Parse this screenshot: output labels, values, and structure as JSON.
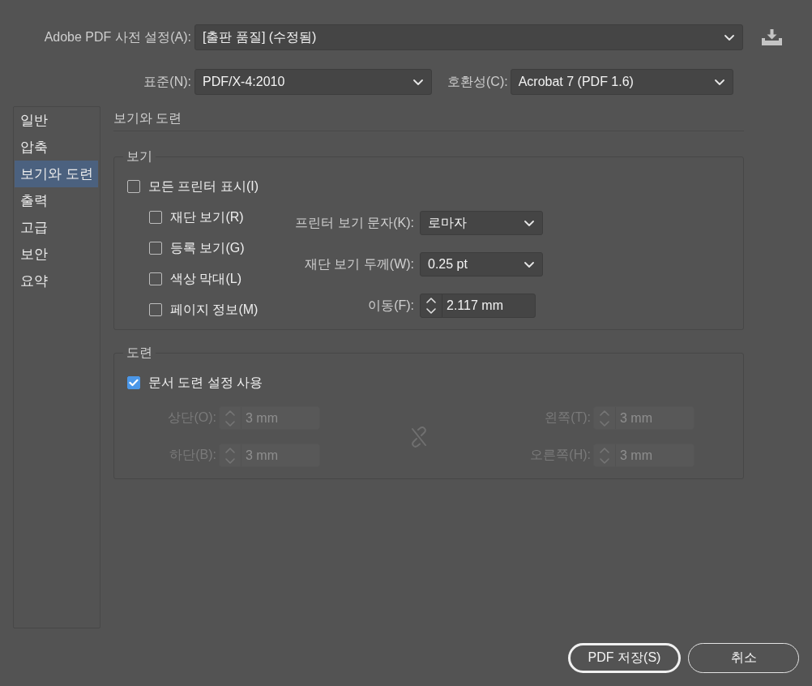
{
  "preset": {
    "label": "Adobe PDF 사전 설정(A):",
    "value": "[출판 품질] (수정됨)"
  },
  "standard": {
    "label": "표준(N):",
    "value": "PDF/X-4:2010"
  },
  "compatibility": {
    "label": "호환성(C):",
    "value": "Acrobat 7 (PDF 1.6)"
  },
  "sidebar": {
    "items": [
      {
        "label": "일반",
        "selected": false
      },
      {
        "label": "압축",
        "selected": false
      },
      {
        "label": "보기와 도련",
        "selected": true
      },
      {
        "label": "출력",
        "selected": false
      },
      {
        "label": "고급",
        "selected": false
      },
      {
        "label": "보안",
        "selected": false
      },
      {
        "label": "요약",
        "selected": false
      }
    ]
  },
  "panel": {
    "title": "보기와 도련",
    "marks": {
      "legend": "보기",
      "all": {
        "label": "모든 프린터 표시(I)",
        "checked": false
      },
      "items": [
        {
          "label": "재단 보기(R)",
          "checked": false
        },
        {
          "label": "등록 보기(G)",
          "checked": false
        },
        {
          "label": "색상 막대(L)",
          "checked": false
        },
        {
          "label": "페이지 정보(M)",
          "checked": false
        }
      ],
      "settings": [
        {
          "kind": "dropdown",
          "label": "프린터 보기 문자(K):",
          "value": "로마자"
        },
        {
          "kind": "dropdown",
          "label": "재단 보기 두께(W):",
          "value": "0.25 pt"
        },
        {
          "kind": "stepper",
          "label": "이동(F):",
          "value": "2.117 mm"
        }
      ]
    },
    "bleed": {
      "legend": "도련",
      "use_document": {
        "label": "문서 도련 설정 사용",
        "checked": true
      },
      "fields": [
        {
          "label": "상단(O):",
          "value": "3 mm",
          "disabled": true
        },
        {
          "label": "왼쪽(T):",
          "value": "3 mm",
          "disabled": true
        },
        {
          "label": "하단(B):",
          "value": "3 mm",
          "disabled": true
        },
        {
          "label": "오른쪽(H):",
          "value": "3 mm",
          "disabled": true
        }
      ]
    }
  },
  "buttons": [
    {
      "label": "PDF 저장(S)",
      "default": true
    },
    {
      "label": "취소",
      "default": false
    }
  ]
}
